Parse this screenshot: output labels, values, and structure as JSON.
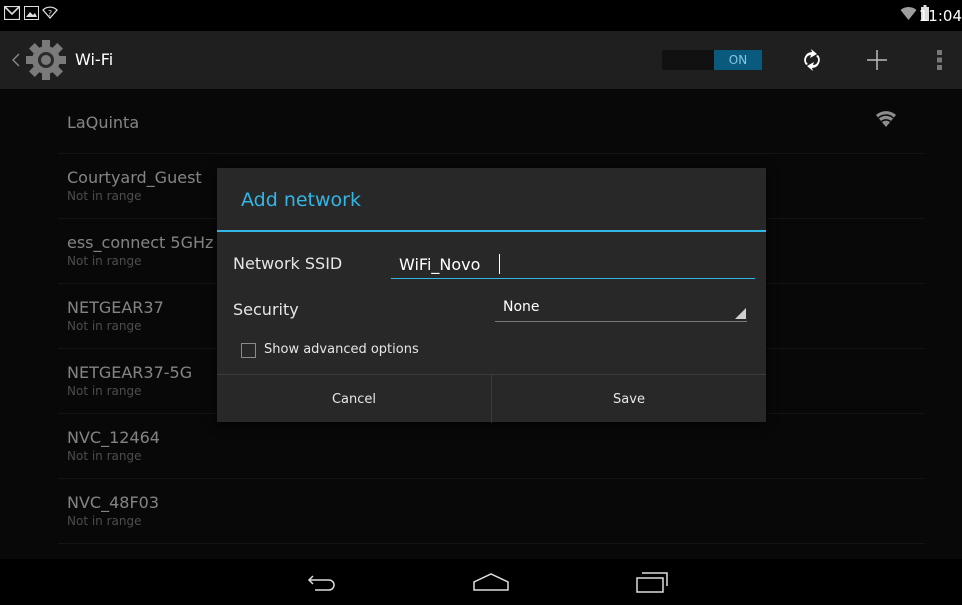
{
  "status_bar": {
    "time": "11:04",
    "left_icons": [
      "gmail-icon",
      "image-notification-icon",
      "wifi-question-icon"
    ],
    "right_icons": [
      "wifi-signal-icon",
      "battery-icon"
    ]
  },
  "action_bar": {
    "title": "Wi-Fi",
    "toggle_label": "ON",
    "icons": [
      "back-chevron-icon",
      "settings-gear-icon",
      "wps-icon",
      "add-icon",
      "overflow-menu-icon"
    ]
  },
  "networks": [
    {
      "name": "LaQuinta",
      "status": ""
    },
    {
      "name": "Courtyard_Guest",
      "status": "Not in range"
    },
    {
      "name": "ess_connect 5GHz",
      "status": "Not in range"
    },
    {
      "name": "NETGEAR37",
      "status": "Not in range"
    },
    {
      "name": "NETGEAR37-5G",
      "status": "Not in range"
    },
    {
      "name": "NVC_12464",
      "status": "Not in range"
    },
    {
      "name": "NVC_48F03",
      "status": "Not in range"
    }
  ],
  "dialog": {
    "title": "Add network",
    "ssid_label": "Network SSID",
    "ssid_value": "WiFi_Novo",
    "security_label": "Security",
    "security_value": "None",
    "advanced_label": "Show advanced options",
    "cancel_label": "Cancel",
    "save_label": "Save"
  },
  "colors": {
    "accent": "#33b5e5",
    "dialog_bg": "#282828",
    "list_bg": "#101010"
  },
  "nav_bar": {
    "icons": [
      "back-icon",
      "home-icon",
      "recents-icon"
    ]
  }
}
